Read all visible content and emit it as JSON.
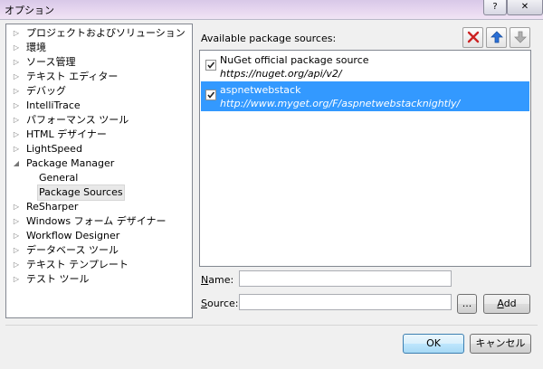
{
  "window": {
    "title": "オプション",
    "help_label": "?",
    "close_label": "✕"
  },
  "tree": {
    "items": [
      {
        "label": "プロジェクトおよびソリューション",
        "arrow": "▷",
        "level": 0
      },
      {
        "label": "環境",
        "arrow": "▷",
        "level": 0
      },
      {
        "label": "ソース管理",
        "arrow": "▷",
        "level": 0
      },
      {
        "label": "テキスト エディター",
        "arrow": "▷",
        "level": 0
      },
      {
        "label": "デバッグ",
        "arrow": "▷",
        "level": 0
      },
      {
        "label": "IntelliTrace",
        "arrow": "▷",
        "level": 0
      },
      {
        "label": "パフォーマンス ツール",
        "arrow": "▷",
        "level": 0
      },
      {
        "label": "HTML デザイナー",
        "arrow": "▷",
        "level": 0
      },
      {
        "label": "LightSpeed",
        "arrow": "▷",
        "level": 0
      },
      {
        "label": "Package Manager",
        "arrow": "◢",
        "level": 0
      },
      {
        "label": "General",
        "arrow": "",
        "level": 1
      },
      {
        "label": "Package Sources",
        "arrow": "",
        "level": 1,
        "selected": true
      },
      {
        "label": "ReSharper",
        "arrow": "▷",
        "level": 0
      },
      {
        "label": "Windows フォーム デザイナー",
        "arrow": "▷",
        "level": 0
      },
      {
        "label": "Workflow Designer",
        "arrow": "▷",
        "level": 0
      },
      {
        "label": "データベース ツール",
        "arrow": "▷",
        "level": 0
      },
      {
        "label": "テキスト テンプレート",
        "arrow": "▷",
        "level": 0
      },
      {
        "label": "テスト ツール",
        "arrow": "▷",
        "level": 0
      }
    ]
  },
  "sources": {
    "heading": "Available package sources:",
    "items": [
      {
        "name": "NuGet official package source",
        "url": "https://nuget.org/api/v2/",
        "checked": true,
        "selected": false
      },
      {
        "name": "aspnetwebstack",
        "url": "http://www.myget.org/F/aspnetwebstacknightly/",
        "checked": true,
        "selected": true
      }
    ]
  },
  "form": {
    "name_label_accel": "N",
    "name_label_rest": "ame:",
    "name_value": "",
    "source_label_accel": "S",
    "source_label_rest": "ource:",
    "source_value": "",
    "browse_label": "...",
    "add_label_accel": "A",
    "add_label_rest": "dd"
  },
  "footer": {
    "ok_label": "OK",
    "cancel_label": "キャンセル"
  },
  "colors": {
    "selection": "#3399ff",
    "remove_icon": "#cc2222",
    "arrow_up_icon": "#2a6fd6",
    "arrow_down_icon": "#9a9a9a"
  }
}
